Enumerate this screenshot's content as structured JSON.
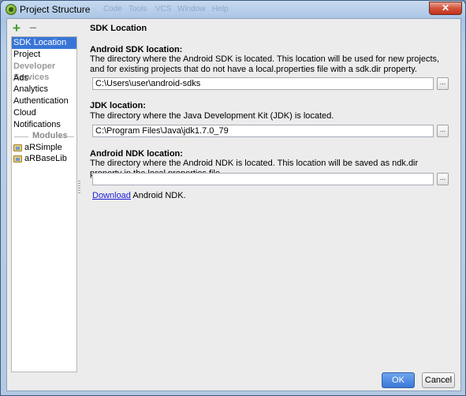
{
  "window": {
    "title": "Project Structure",
    "ghost_menus": [
      "Code",
      "Tools",
      "VCS",
      "Window",
      "Help"
    ],
    "close_glyph": "✕"
  },
  "toolbar": {
    "add_glyph": "+",
    "remove_glyph": "−"
  },
  "sidebar": {
    "items": [
      "SDK Location",
      "Project"
    ],
    "developer_services_header": "Developer Services",
    "services": [
      "Ads",
      "Analytics",
      "Authentication",
      "Cloud",
      "Notifications"
    ],
    "modules_header": "Modules",
    "modules": [
      "aRSimple",
      "aRBaseLib"
    ]
  },
  "main": {
    "title": "SDK Location",
    "sdk": {
      "label": "Android SDK location:",
      "description": "The directory where the Android SDK is located. This location will be used for new projects, and for existing projects that do not have a local.properties file with a sdk.dir property.",
      "value": "C:\\Users\\user\\android-sdks"
    },
    "jdk": {
      "label": "JDK location:",
      "description": "The directory where the Java Development Kit (JDK) is located.",
      "value": "C:\\Program Files\\Java\\jdk1.7.0_79"
    },
    "ndk": {
      "label": "Android NDK location:",
      "description": "The directory where the Android NDK is located. This location will be saved as ndk.dir property in the local.properties file.",
      "value": "",
      "download_link": "Download",
      "download_suffix": " Android NDK."
    },
    "browse_glyph": "..."
  },
  "footer": {
    "ok_label": "OK",
    "cancel_label": "Cancel"
  },
  "colors": {
    "selection": "#3875d7",
    "ok_button": "#3b78d8",
    "link": "#1c1cd6"
  }
}
